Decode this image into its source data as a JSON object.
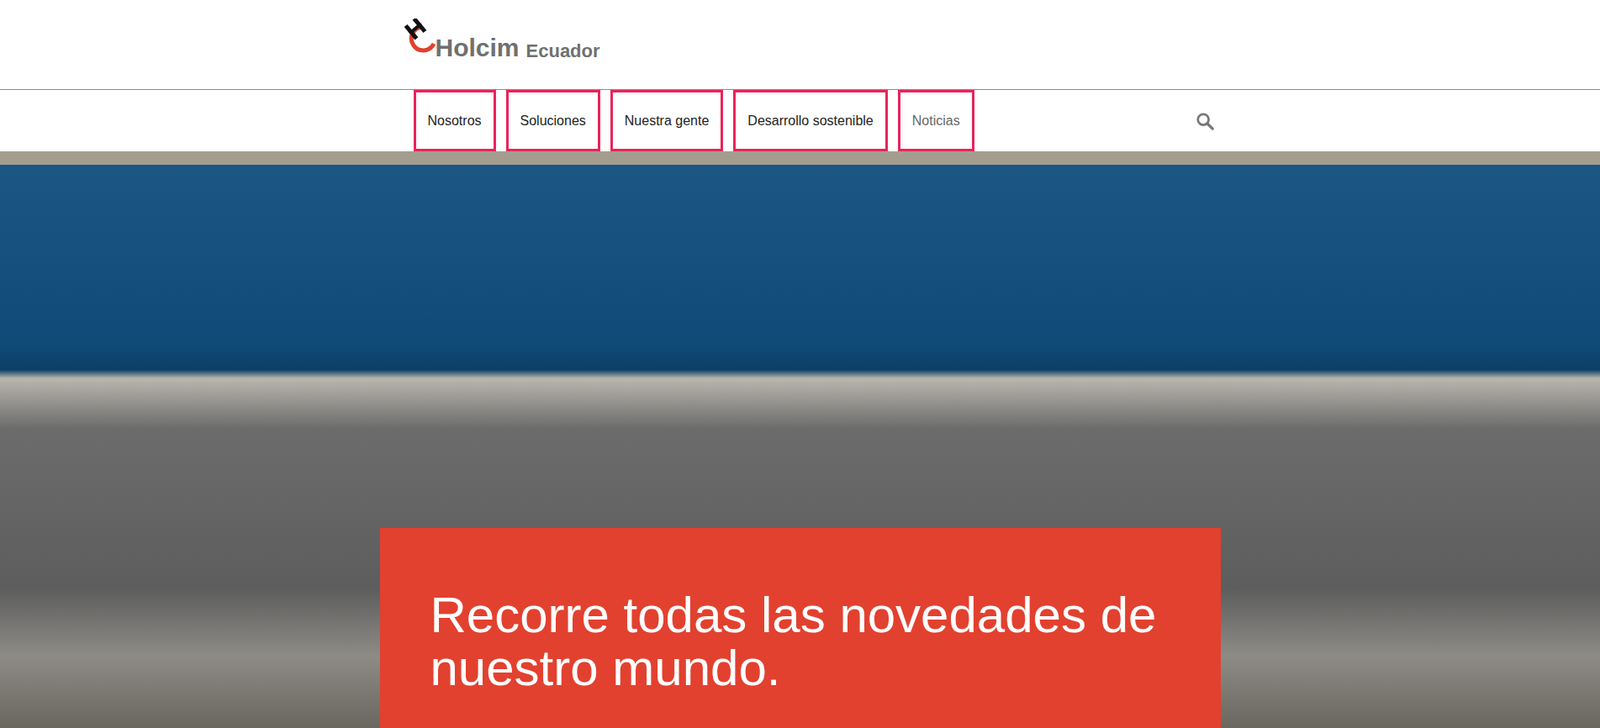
{
  "logo": {
    "brand": "Holcim",
    "region": "Ecuador"
  },
  "nav": {
    "items": [
      {
        "label": "Nosotros",
        "selected": false
      },
      {
        "label": "Soluciones",
        "selected": false
      },
      {
        "label": "Nuestra gente",
        "selected": false
      },
      {
        "label": "Desarrollo sostenible",
        "selected": false
      },
      {
        "label": "Noticias",
        "selected": true
      }
    ]
  },
  "hero": {
    "headline": "Recorre todas las novedades de nuestro mundo."
  }
}
